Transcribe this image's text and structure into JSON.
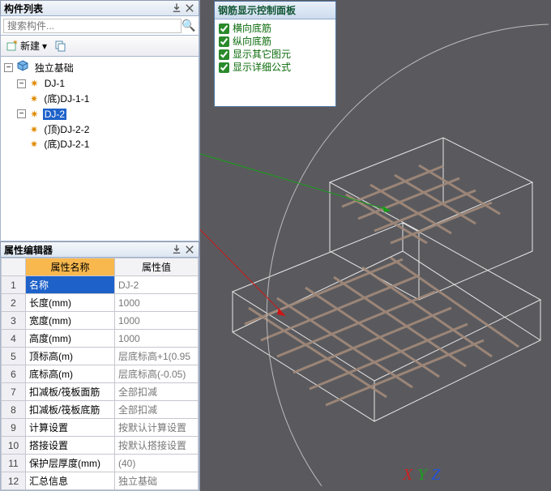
{
  "componentList": {
    "title": "构件列表",
    "searchPlaceholder": "搜索构件...",
    "newButton": "新建",
    "tree": {
      "root": {
        "label": "独立基础"
      },
      "dj1": {
        "label": "DJ-1"
      },
      "dj1b": {
        "label": "(底)DJ-1-1"
      },
      "dj2": {
        "label": "DJ-2"
      },
      "dj2t": {
        "label": "(顶)DJ-2-2"
      },
      "dj2b": {
        "label": "(底)DJ-2-1"
      }
    }
  },
  "propertyEditor": {
    "title": "属性编辑器",
    "nameHeader": "属性名称",
    "valueHeader": "属性值",
    "rows": [
      {
        "n": "1",
        "name": "名称",
        "value": "DJ-2"
      },
      {
        "n": "2",
        "name": "长度(mm)",
        "value": "1000"
      },
      {
        "n": "3",
        "name": "宽度(mm)",
        "value": "1000"
      },
      {
        "n": "4",
        "name": "高度(mm)",
        "value": "1000"
      },
      {
        "n": "5",
        "name": "顶标高(m)",
        "value": "层底标高+1(0.95"
      },
      {
        "n": "6",
        "name": "底标高(m)",
        "value": "层底标高(-0.05)"
      },
      {
        "n": "7",
        "name": "扣减板/筏板面筋",
        "value": "全部扣减"
      },
      {
        "n": "8",
        "name": "扣减板/筏板底筋",
        "value": "全部扣减"
      },
      {
        "n": "9",
        "name": "计算设置",
        "value": "按默认计算设置"
      },
      {
        "n": "10",
        "name": "搭接设置",
        "value": "按默认搭接设置"
      },
      {
        "n": "11",
        "name": "保护层厚度(mm)",
        "value": "(40)"
      },
      {
        "n": "12",
        "name": "汇总信息",
        "value": "独立基础"
      }
    ]
  },
  "rebarPanel": {
    "title": "钢筋显示控制面板",
    "opts": {
      "o1": "横向底筋",
      "o2": "纵向底筋",
      "o3": "显示其它图元",
      "o4": "显示详细公式"
    }
  },
  "axes": {
    "x": "X",
    "y": "Y",
    "z": "Z"
  }
}
